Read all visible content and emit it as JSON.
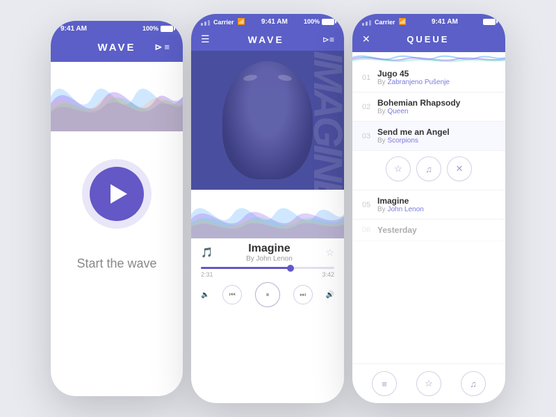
{
  "app": {
    "name": "WAVE",
    "time": "9:41 AM",
    "battery": "100%",
    "carrier": "Carrier"
  },
  "screen1": {
    "title": "WAVE",
    "start_text": "Start the wave",
    "play_btn_label": "Play"
  },
  "screen2": {
    "title": "WAVE",
    "song": {
      "title": "Imagine",
      "artist": "By John Lenon",
      "current_time": "2:31",
      "total_time": "3:42",
      "progress_pct": 67
    },
    "controls": {
      "volume_down": "🔈",
      "prev": "⏮",
      "pause": "⏸",
      "next": "⏭",
      "volume_up": "🔊"
    }
  },
  "screen3": {
    "title": "QUEUE",
    "items": [
      {
        "num": "01",
        "title": "Jugo 45",
        "artist": "Zabranjeno Pušenje",
        "artist_color": true
      },
      {
        "num": "02",
        "title": "Bohemian Rhapsody",
        "artist": "Queen",
        "artist_color": true
      },
      {
        "num": "03",
        "title": "Send me an Angel",
        "artist": "Scorpions",
        "artist_color": true,
        "active": true
      },
      {
        "num": "05",
        "title": "Imagine",
        "artist": "John Lenon",
        "artist_color": true
      },
      {
        "num": "06",
        "title": "Yesterday",
        "artist": "",
        "artist_color": false,
        "dimmed": true
      }
    ],
    "action_btns": [
      "★",
      "♫",
      "✕"
    ],
    "footer_btns": [
      "≡",
      "★",
      "♫"
    ]
  }
}
